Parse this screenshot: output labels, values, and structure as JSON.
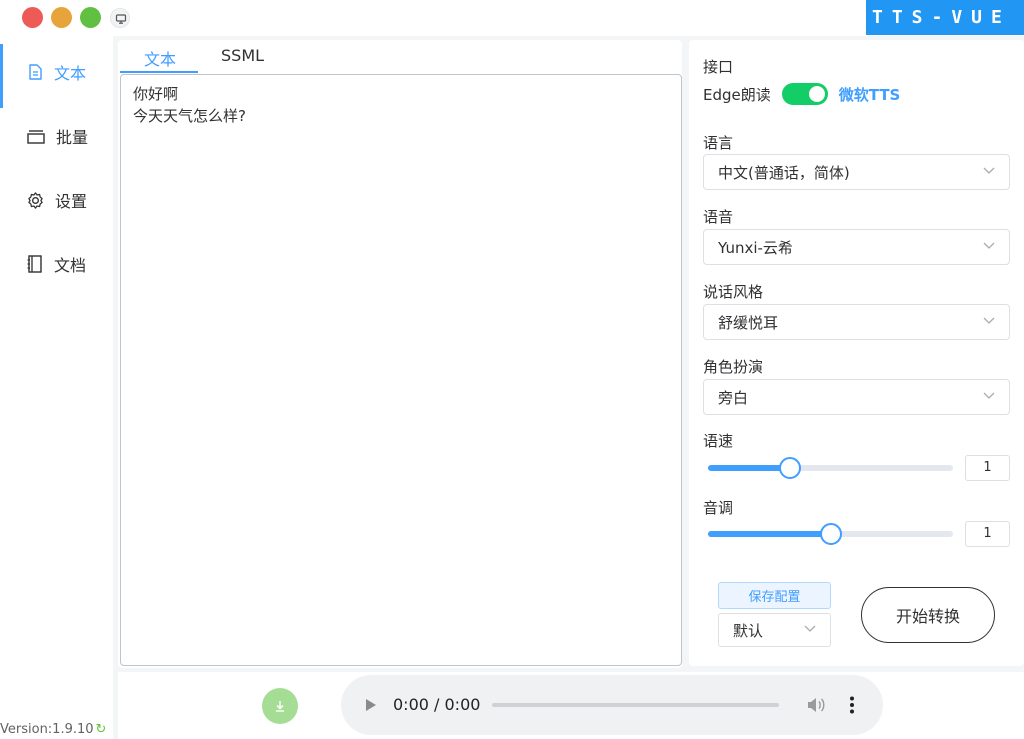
{
  "app": {
    "brand": "TTS-VUE",
    "version": "Version:1.9.10"
  },
  "sidebar": {
    "items": [
      {
        "label": "文本",
        "icon": "document-icon"
      },
      {
        "label": "批量",
        "icon": "stack-icon"
      },
      {
        "label": "设置",
        "icon": "gear-icon"
      },
      {
        "label": "文档",
        "icon": "notebook-icon"
      }
    ]
  },
  "editor": {
    "tabs": [
      {
        "label": "文本"
      },
      {
        "label": "SSML"
      }
    ],
    "content": "你好啊\n今天天气怎么样?"
  },
  "settings": {
    "api_label": "接口",
    "edge_label": "Edge朗读",
    "toggle_on": true,
    "ms_label": "微软TTS",
    "language_label": "语言",
    "language_value": "中文(普通话，简体)",
    "voice_label": "语音",
    "voice_value": "Yunxi-云希",
    "style_label": "说话风格",
    "style_value": "舒缓悦耳",
    "role_label": "角色扮演",
    "role_value": "旁白",
    "rate_label": "语速",
    "rate_value": "1",
    "rate_fraction": 0.335,
    "pitch_label": "音调",
    "pitch_value": "1",
    "pitch_fraction": 0.5,
    "save_config": "保存配置",
    "preset_value": "默认",
    "start_button": "开始转换"
  },
  "player": {
    "time": "0:00 / 0:00"
  },
  "colors": {
    "accent": "#409eff",
    "brand": "#2196f3",
    "toggle": "#13ce66",
    "download": "#a6dd94"
  }
}
